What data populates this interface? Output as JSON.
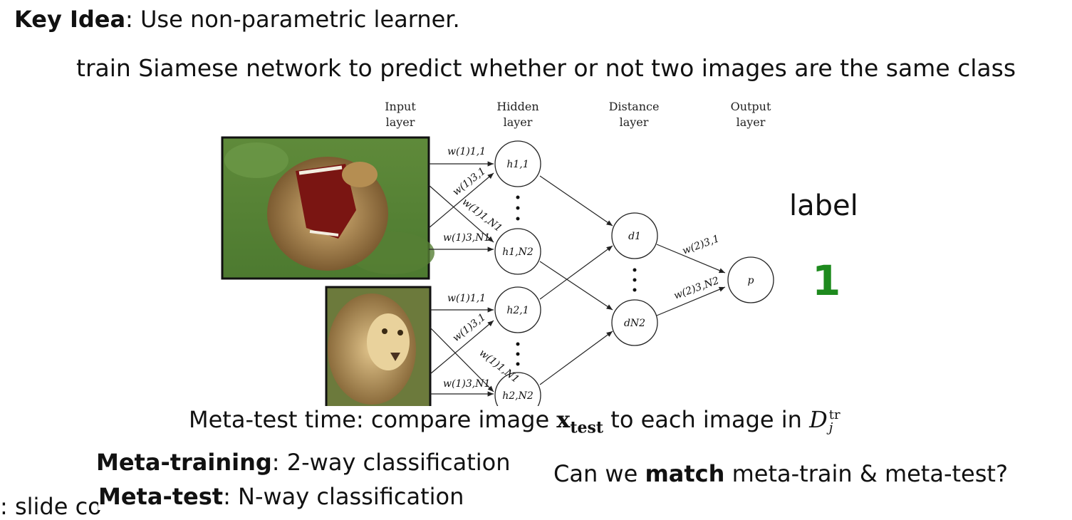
{
  "heading": {
    "bold": "Key Idea",
    "rest": ": Use non-parametric learner."
  },
  "subheading": "train Siamese network to predict whether or not two images are the same class",
  "diagram": {
    "layers": [
      {
        "line1": "Input",
        "line2": "layer"
      },
      {
        "line1": "Hidden",
        "line2": "layer"
      },
      {
        "line1": "Distance",
        "line2": "layer"
      },
      {
        "line1": "Output",
        "line2": "layer"
      }
    ],
    "nodes": {
      "h11": "h1,1",
      "h1n": "h1,N2",
      "h21": "h2,1",
      "h2n": "h2,N2",
      "d1": "d1",
      "dn": "dN2",
      "p": "p"
    },
    "weights": {
      "w11": "w(1)1,1",
      "w31": "w(1)3,1",
      "w1n": "w(1)1,N1",
      "w3n": "w(1)3,N1",
      "w2_31": "w(2)3,1",
      "w2_3n": "w(2)3,N2"
    },
    "images": [
      "lion-roaring",
      "lion-face"
    ]
  },
  "side": {
    "label": "label",
    "value": "1",
    "value_color": "#1e8a1e"
  },
  "meta_test_time": {
    "before": "Meta-test time: compare image ",
    "var": "x",
    "var_sub": "test",
    "middle": " to each image in ",
    "set": "D",
    "set_sup": "tr",
    "set_sub": "j"
  },
  "meta_training": {
    "bold": "Meta-training",
    "rest": ": 2-way classification"
  },
  "meta_test": {
    "bold": "Meta-test",
    "rest": ": N-way classification"
  },
  "ghost_text": ": slide co",
  "match_q": {
    "before": "Can we ",
    "bold": "match",
    "after": " meta-train & meta-test?"
  }
}
